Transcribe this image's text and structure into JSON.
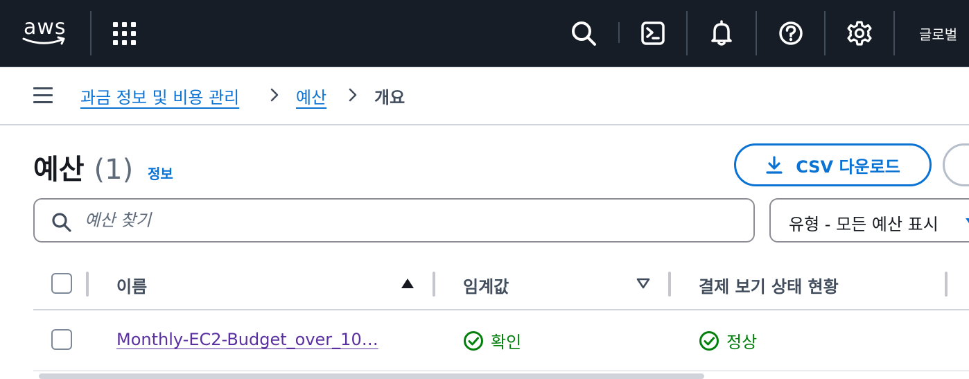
{
  "topnav": {
    "logo_text": "aws",
    "region_label": "글로벌",
    "icons": [
      "apps-grid-icon",
      "search-icon",
      "cloudshell-icon",
      "notifications-icon",
      "help-icon",
      "settings-icon"
    ]
  },
  "breadcrumb": {
    "items": [
      {
        "label": "과금 정보 및 비용 관리"
      },
      {
        "label": "예산"
      },
      {
        "label": "개요"
      }
    ]
  },
  "header": {
    "title": "예산",
    "count": "(1)",
    "info_label": "정보",
    "csv_button_label": "CSV 다운로드"
  },
  "search": {
    "placeholder": "예산 찾기"
  },
  "filter": {
    "selected_label": "유형 - 모든 예산 표시"
  },
  "table": {
    "columns": [
      {
        "label": "이름",
        "sort": "ascending"
      },
      {
        "label": "임계값",
        "sort": "descending"
      },
      {
        "label": "결제 보기 상태 현황",
        "sort": "none"
      }
    ],
    "rows": [
      {
        "name": "Monthly-EC2-Budget_over_10…",
        "threshold": "확인",
        "billing_status": "정상"
      }
    ]
  },
  "colors": {
    "nav_bg": "#161d26",
    "link": "#0972d3",
    "visited_link": "#5a2fa0",
    "success": "#037f0c"
  }
}
